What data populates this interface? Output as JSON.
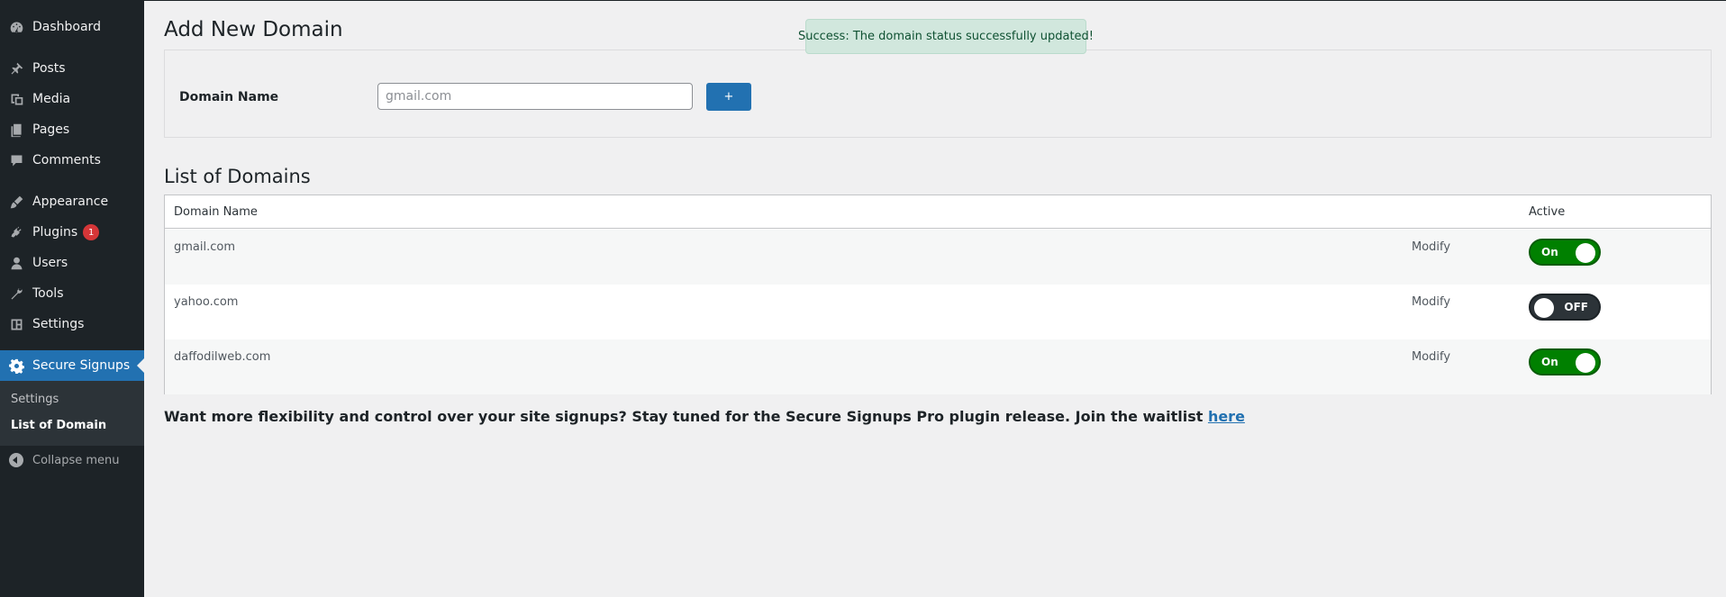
{
  "sidebar": {
    "items": [
      {
        "label": "Dashboard",
        "icon": "dashboard-icon"
      },
      {
        "label": "Posts",
        "icon": "pin-icon"
      },
      {
        "label": "Media",
        "icon": "media-icon"
      },
      {
        "label": "Pages",
        "icon": "pages-icon"
      },
      {
        "label": "Comments",
        "icon": "comment-icon"
      },
      {
        "label": "Appearance",
        "icon": "brush-icon"
      },
      {
        "label": "Plugins",
        "icon": "plugin-icon",
        "badge": "1"
      },
      {
        "label": "Users",
        "icon": "user-icon"
      },
      {
        "label": "Tools",
        "icon": "wrench-icon"
      },
      {
        "label": "Settings",
        "icon": "settings-icon"
      },
      {
        "label": "Secure Signups",
        "icon": "gear-icon"
      }
    ],
    "submenu": [
      "Settings",
      "List of Domain"
    ],
    "collapse_label": "Collapse menu"
  },
  "notice": "Success: The domain status successfully updated!",
  "add_section": {
    "title": "Add New Domain",
    "field_label": "Domain Name",
    "placeholder": "gmail.com",
    "button_label": "+"
  },
  "list_section": {
    "title": "List of Domains",
    "headers": {
      "name": "Domain Name",
      "active": "Active"
    },
    "rows": [
      {
        "domain": "gmail.com",
        "action": "Modify",
        "status": "On"
      },
      {
        "domain": "yahoo.com",
        "action": "Modify",
        "status": "OFF"
      },
      {
        "domain": "daffodilweb.com",
        "action": "Modify",
        "status": "On"
      }
    ]
  },
  "footer": {
    "text": "Want more flexibility and control over your site signups? Stay tuned for the Secure Signups Pro plugin release. Join the waitlist ",
    "link": "here"
  },
  "colors": {
    "accent": "#2271b1",
    "sidebar": "#1d2327",
    "toggle_on": "#008000",
    "toggle_off": "#2c3338"
  }
}
